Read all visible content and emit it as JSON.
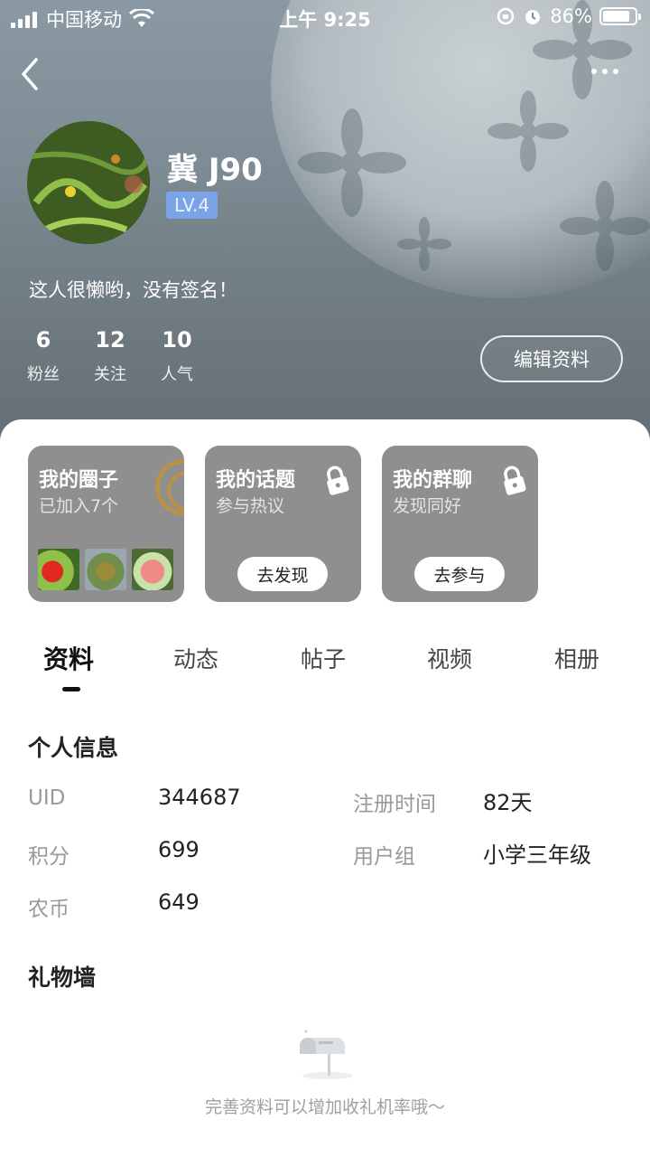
{
  "status_bar": {
    "carrier": "中国移动",
    "time": "上午 9:25",
    "battery": "86%",
    "battery_level": 0.86
  },
  "nav": {
    "back_icon": "chevron-left-icon",
    "more_icon": "more-horizontal-icon"
  },
  "profile": {
    "username": "冀 J90",
    "level": "LV.4",
    "signature": "这人很懒哟，没有签名！",
    "edit_button": "编辑资料",
    "stats": [
      {
        "value": "6",
        "label": "粉丝"
      },
      {
        "value": "12",
        "label": "关注"
      },
      {
        "value": "10",
        "label": "人气"
      }
    ]
  },
  "cards": [
    {
      "title": "我的圈子",
      "subtitle": "已加入7个"
    },
    {
      "title": "我的话题",
      "subtitle": "参与热议",
      "button": "去发现",
      "icon": "lock-icon"
    },
    {
      "title": "我的群聊",
      "subtitle": "发现同好",
      "button": "去参与",
      "icon": "lock-icon"
    }
  ],
  "tabs": [
    "资料",
    "动态",
    "帖子",
    "视频",
    "相册"
  ],
  "active_tab": "资料",
  "personal_info": {
    "title": "个人信息",
    "rows": [
      {
        "label": "UID",
        "value": "344687"
      },
      {
        "label": "注册时间",
        "value": "82天"
      },
      {
        "label": "积分",
        "value": "699"
      },
      {
        "label": "用户组",
        "value": "小学三年级"
      },
      {
        "label": "农币",
        "value": "649"
      }
    ]
  },
  "gift_wall": {
    "title": "礼物墙",
    "empty_text": "完善资料可以增加收礼机率哦～",
    "empty_icon": "mailbox-icon"
  },
  "colors": {
    "level_badge": "#7aa3e8",
    "card_bg": "#8f8f8f",
    "header_bg": "#7e8c95"
  }
}
